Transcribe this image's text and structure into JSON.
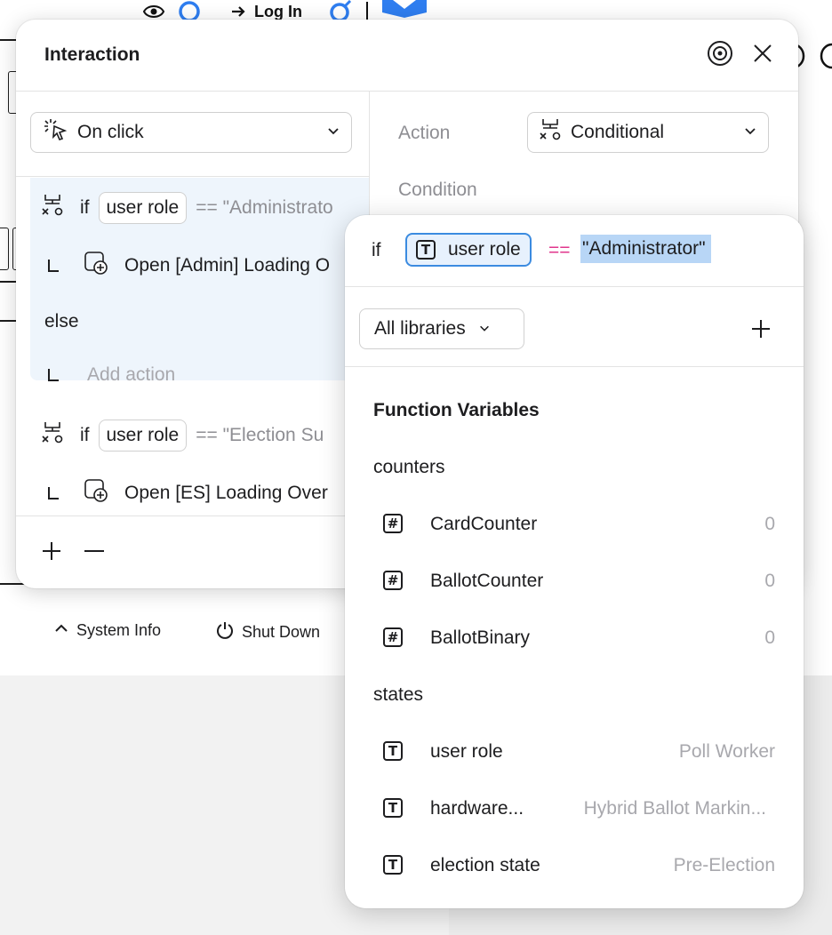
{
  "toolbar": {
    "login_label": "Log In"
  },
  "footer": {
    "system_info": "System Info",
    "shut_down": "Shut Down"
  },
  "panel": {
    "title": "Interaction",
    "trigger": {
      "label": "On click"
    },
    "action_label": "Action",
    "action_value": "Conditional",
    "condition_label": "Condition",
    "rules": [
      {
        "keyword": "if",
        "variable": "user role",
        "comparison": "== \"Administrato",
        "action": "Open [Admin] Loading O"
      },
      {
        "else_label": "else",
        "add_action": "Add action"
      },
      {
        "keyword": "if",
        "variable": "user role",
        "comparison": "== \"Election Su",
        "action": "Open [ES] Loading Over"
      }
    ]
  },
  "popover": {
    "expr_if": "if",
    "expr_variable": "user role",
    "expr_operator": "==",
    "expr_value": "\"Administrator\"",
    "library_select": "All libraries",
    "section_title": "Function Variables",
    "groups": [
      {
        "name": "counters",
        "vars": [
          {
            "icon": "hash-icon",
            "name": "CardCounter",
            "value": "0"
          },
          {
            "icon": "hash-icon",
            "name": "BallotCounter",
            "value": "0"
          },
          {
            "icon": "hash-icon",
            "name": "BallotBinary",
            "value": "0"
          }
        ]
      },
      {
        "name": "states",
        "vars": [
          {
            "icon": "text-icon",
            "name": "user role",
            "value": "Poll Worker"
          },
          {
            "icon": "text-icon",
            "name": "hardware...",
            "value": "Hybrid Ballot Markin..."
          },
          {
            "icon": "text-icon",
            "name": "election state",
            "value": "Pre-Election"
          }
        ]
      }
    ]
  },
  "colors": {
    "accent": "#3b8be0",
    "operator": "#e0368c",
    "selection": "#b8d6f6",
    "block_bg": "#eef5fc"
  }
}
